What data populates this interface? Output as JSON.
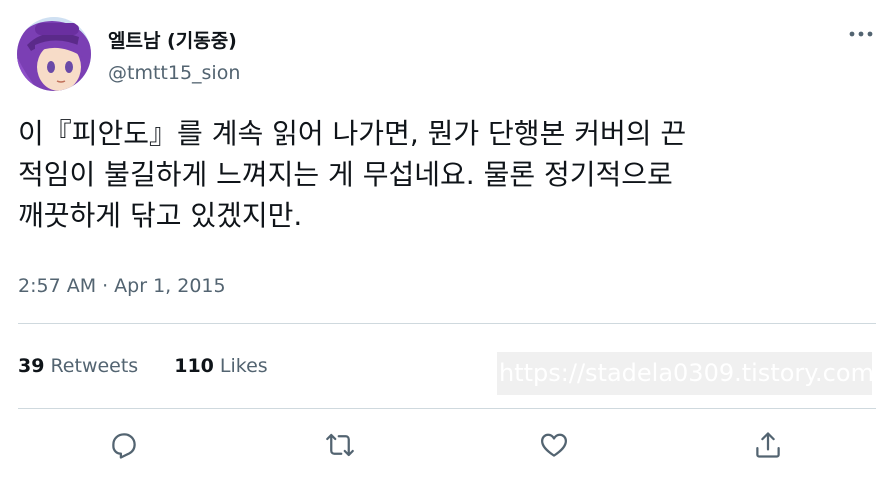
{
  "author": {
    "display_name": "엘트남 (기동중)",
    "handle": "@tmtt15_sion",
    "avatar_icon": "anime-avatar-icon"
  },
  "tweet": {
    "lines": [
      "이『피안도』를 계속 읽어 나가면, 뭔가 단행본 커버의 끈",
      "적임이 불길하게 느껴지는 게 무섭네요. 물론 정기적으로",
      "깨끗하게 닦고 있겠지만."
    ],
    "time": "2:57 AM",
    "separator": "·",
    "date": "Apr 1, 2015"
  },
  "stats": {
    "retweets_count": "39",
    "retweets_label": "Retweets",
    "likes_count": "110",
    "likes_label": "Likes"
  },
  "watermark": "https://stadela0309.tistory.com",
  "actions": {
    "reply_icon": "reply-icon",
    "retweet_icon": "retweet-icon",
    "like_icon": "heart-icon",
    "share_icon": "share-icon",
    "more_icon": "more-icon"
  },
  "colors": {
    "text": "#0f1419",
    "secondary": "#536471",
    "divider": "#cfd9de",
    "avatar_bg": "#7b3fb4"
  }
}
